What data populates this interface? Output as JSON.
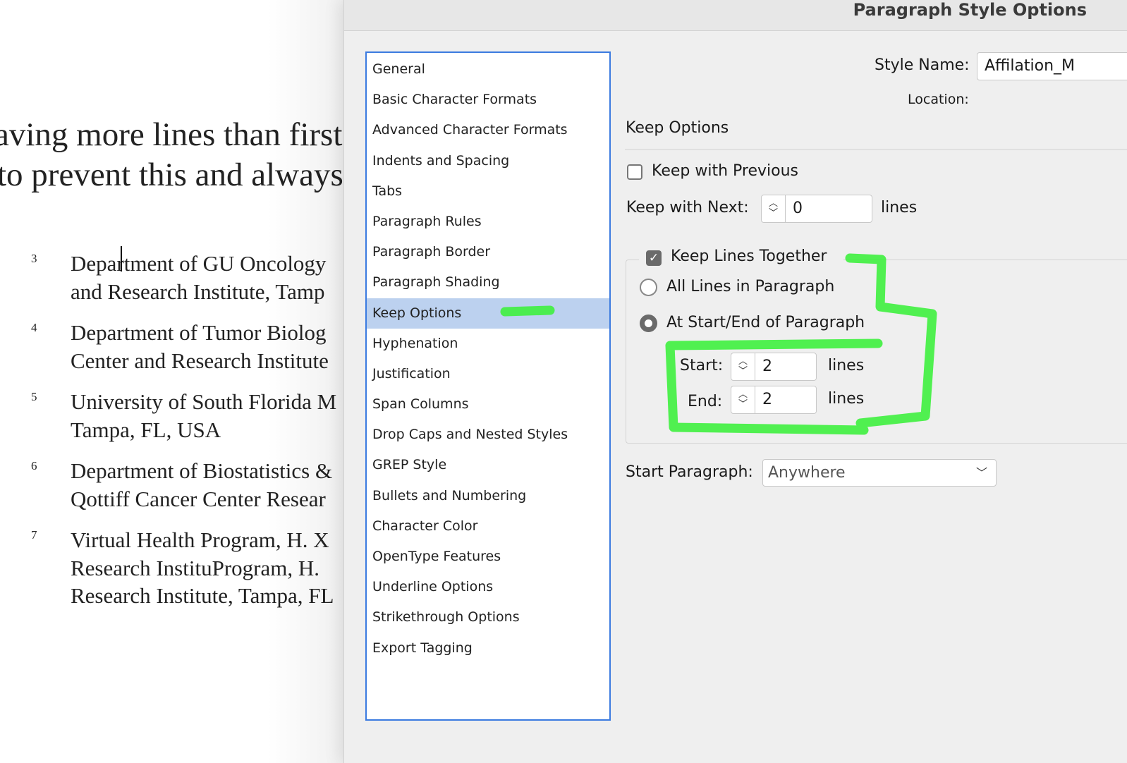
{
  "document": {
    "lines": [
      "aving more lines than first",
      "to prevent this and always"
    ],
    "affiliations": [
      {
        "num": "3",
        "lines": [
          "Department of GU Oncology",
          "and Research Institute, Tamp"
        ]
      },
      {
        "num": "4",
        "lines": [
          "Department of Tumor Biolog",
          "Center and Research Institute"
        ]
      },
      {
        "num": "5",
        "lines": [
          "University of South Florida M",
          "Tampa, FL, USA"
        ]
      },
      {
        "num": "6",
        "lines": [
          "Department of Biostatistics &",
          "Qottiff Cancer Center Resear"
        ]
      },
      {
        "num": "7",
        "lines": [
          "Virtual Health Program, H. X",
          "Research InstituProgram, H.",
          "Research Institute, Tampa, FL"
        ]
      }
    ]
  },
  "dialog": {
    "title": "Paragraph Style Options",
    "categories": [
      "General",
      "Basic Character Formats",
      "Advanced Character Formats",
      "Indents and Spacing",
      "Tabs",
      "Paragraph Rules",
      "Paragraph Border",
      "Paragraph Shading",
      "Keep Options",
      "Hyphenation",
      "Justification",
      "Span Columns",
      "Drop Caps and Nested Styles",
      "GREP Style",
      "Bullets and Numbering",
      "Character Color",
      "OpenType Features",
      "Underline Options",
      "Strikethrough Options",
      "Export Tagging"
    ],
    "selected": "Keep Options",
    "style_name_label": "Style Name:",
    "style_name_value": "Affilation_M",
    "location_label": "Location:",
    "section_title": "Keep Options",
    "keep_with_previous": {
      "label": "Keep with Previous",
      "checked": false
    },
    "keep_with_next": {
      "label": "Keep with Next:",
      "value": "0",
      "unit": "lines"
    },
    "keep_lines_together": {
      "label": "Keep Lines Together",
      "checked": true
    },
    "all_lines": {
      "label": "All Lines in Paragraph",
      "selected": false
    },
    "start_end": {
      "label": "At Start/End of Paragraph",
      "selected": true
    },
    "start": {
      "label": "Start:",
      "value": "2",
      "unit": "lines"
    },
    "end": {
      "label": "End:",
      "value": "2",
      "unit": "lines"
    },
    "start_paragraph": {
      "label": "Start Paragraph:",
      "value": "Anywhere"
    }
  },
  "annotation_color": "#3ef03e"
}
